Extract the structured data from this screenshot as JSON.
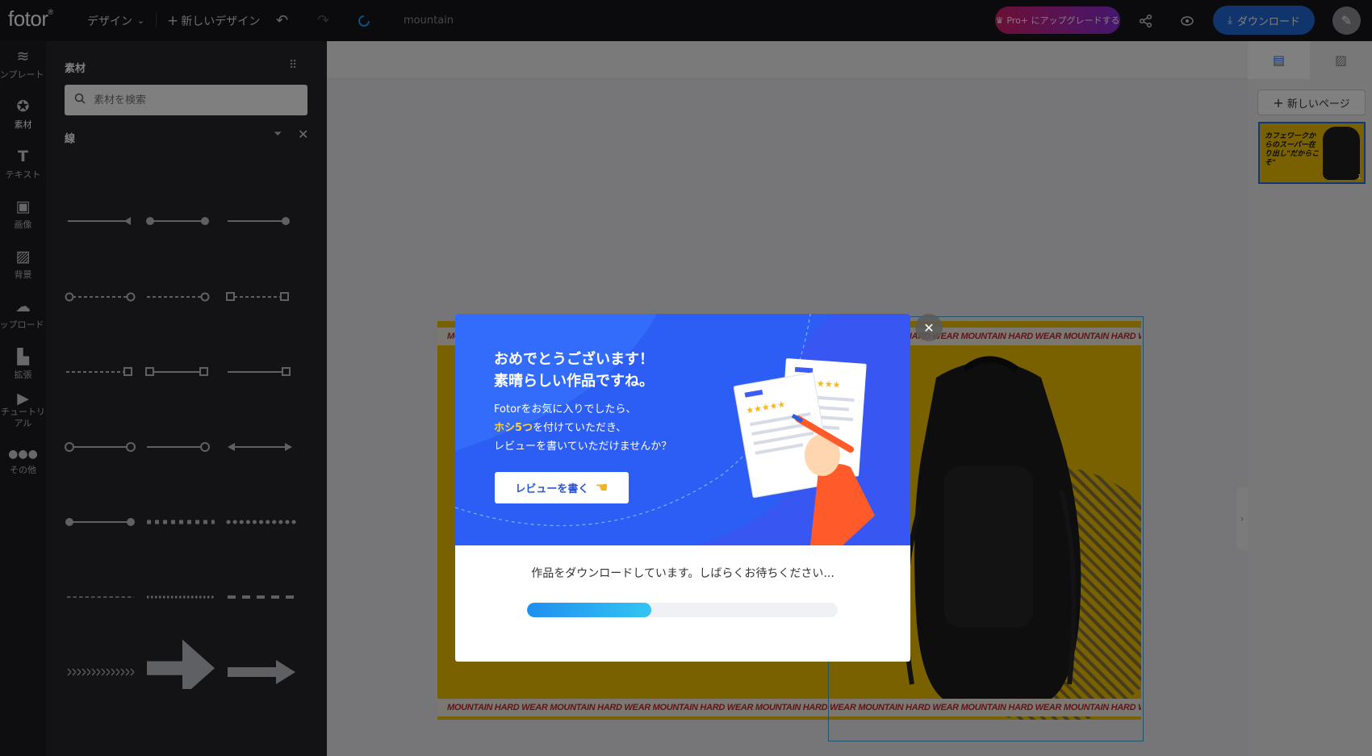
{
  "header": {
    "logo": "fotor",
    "logo_mark": "®",
    "design_menu": "デザイン",
    "new_design": "新しいデザイン",
    "doc_name": "mountain",
    "pro_label": "Pro+ にアップグレードする",
    "download_label": "ダウンロード"
  },
  "rail": {
    "items": [
      {
        "label": "テンプレート",
        "icon": "layers-icon"
      },
      {
        "label": "素材",
        "icon": "star-icon"
      },
      {
        "label": "テキスト",
        "icon": "text-icon"
      },
      {
        "label": "画像",
        "icon": "image-icon"
      },
      {
        "label": "背景",
        "icon": "background-icon"
      },
      {
        "label": "アップロード",
        "icon": "upload-icon"
      },
      {
        "label": "拡張",
        "icon": "apps-icon"
      },
      {
        "label": "チュートリアル",
        "icon": "play-icon"
      },
      {
        "label": "その他",
        "icon": "more-icon"
      }
    ]
  },
  "panel": {
    "title": "素材",
    "search_placeholder": "素材を検索",
    "category": "線"
  },
  "design": {
    "band_text": "MOUNTAIN HARD WEAR MOUNTAIN HARD WEAR MOUNTAIN HARD WEAR MOUNTAIN HARD WEAR MOUNTAIN HARD WEAR MOUNTAIN HARD WEAR MOUNTAIN HARD WEAR MOUNTAIN HARD WEAR",
    "top_band_visible": "M                                                                                                                    HARD WEAR MOUNTAIN HARD WEAR MOUNTAIN HARD WEAR"
  },
  "rightbar": {
    "new_page": "新しいページ",
    "thumb_text": "カフェワークからのスーパー在り出し\"だからこそ\"",
    "page_number": "1"
  },
  "modal": {
    "title_line1": "おめでとうございます！",
    "title_line2": "素晴らしい作品ですね。",
    "body_line1": "Fotorをお気に入りでしたら、",
    "body_highlight": "ホシ5つ",
    "body_line2_rest": "を付けていただき、",
    "body_line3": "レビューを書いていただけませんか？",
    "review_button": "レビューを書く",
    "status": "作品をダウンロードしています。しばらくお待ちください...",
    "progress": 0.4
  },
  "colors": {
    "accent": "#2c5df4",
    "progress_start": "#1f8ff0",
    "progress_end": "#33c5f2",
    "design_bg": "#f2c200",
    "band_text": "#c9272e"
  }
}
